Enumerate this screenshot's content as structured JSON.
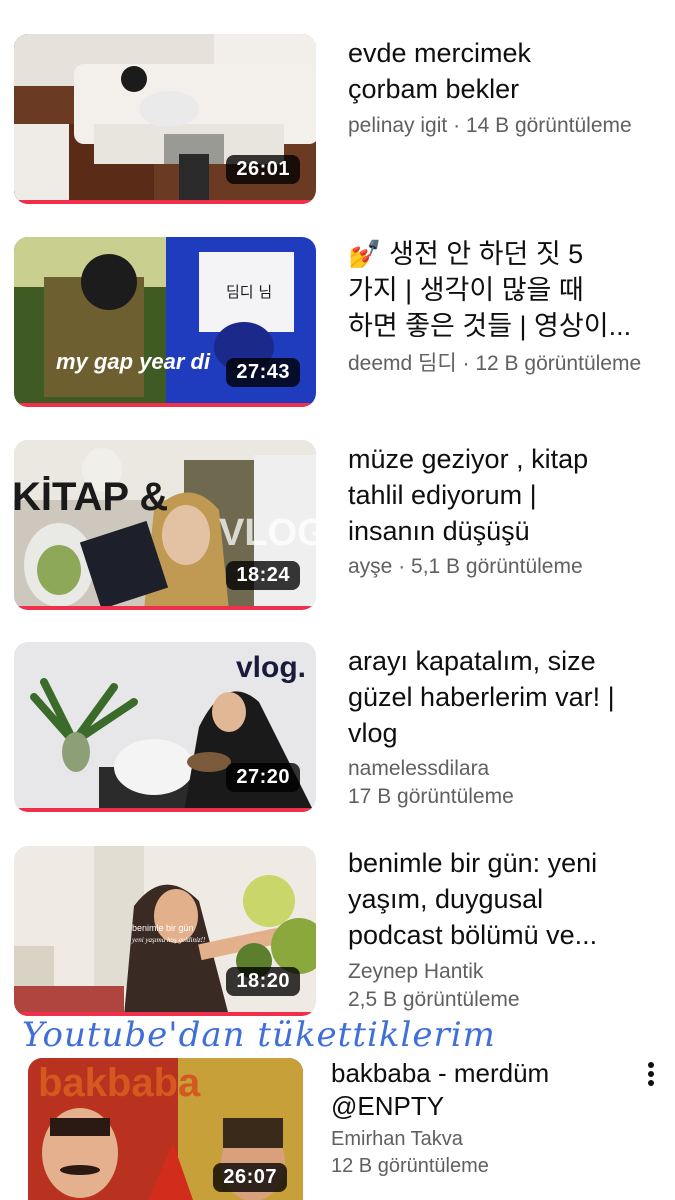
{
  "videos": [
    {
      "title": "evde mercimek\nçorbam bekler",
      "channel": "pelinay igit",
      "views": "14 B görüntüleme",
      "duration": "26:01"
    },
    {
      "title": "💅 생전 안 하던 짓 5\n가지 | 생각이 많을 때\n하면 좋은 것들 | 영상이...",
      "channel": "deemd 딤디",
      "views": "12 B görüntüleme",
      "duration": "27:43",
      "thumb_text": "my gap year di",
      "thumb_sign": "딤디 님"
    },
    {
      "title": "müze geziyor , kitap\ntahlil ediyorum |\ninsanın düşüşü",
      "channel": "ayşe",
      "views": "5,1 B görüntüleme",
      "duration": "18:24",
      "thumb_text_1": "KİTAP &",
      "thumb_text_2": "VLOG"
    },
    {
      "title": "arayı kapatalım, size\ngüzel haberlerim var! |\nvlog",
      "channel": "namelessdilara",
      "views": "17 B görüntüleme",
      "duration": "27:20",
      "thumb_text": "vlog."
    },
    {
      "title": "benimle bir gün: yeni\nyaşım, duygusal\npodcast bölümü ve...",
      "channel": "Zeynep Hantik",
      "views": "2,5 B görüntüleme",
      "duration": "18:20",
      "thumb_text_1": "benimle bir gün",
      "thumb_text_2": "yeni yaşıma hoş geldiniz!!"
    },
    {
      "title": "bakbaba - merdüm\n@ENPTY",
      "channel": "Emirhan Takva",
      "views": "12 B görüntüleme",
      "duration": "26:07",
      "thumb_text": "bakbaba"
    }
  ],
  "handwriting": "Youtube'dan tükettiklerim",
  "separator": " · ",
  "colors": {
    "progress": "#f0304a",
    "meta": "#606060",
    "ink": "#3f6fd8"
  },
  "icons": {
    "more": "more-vertical-icon"
  }
}
